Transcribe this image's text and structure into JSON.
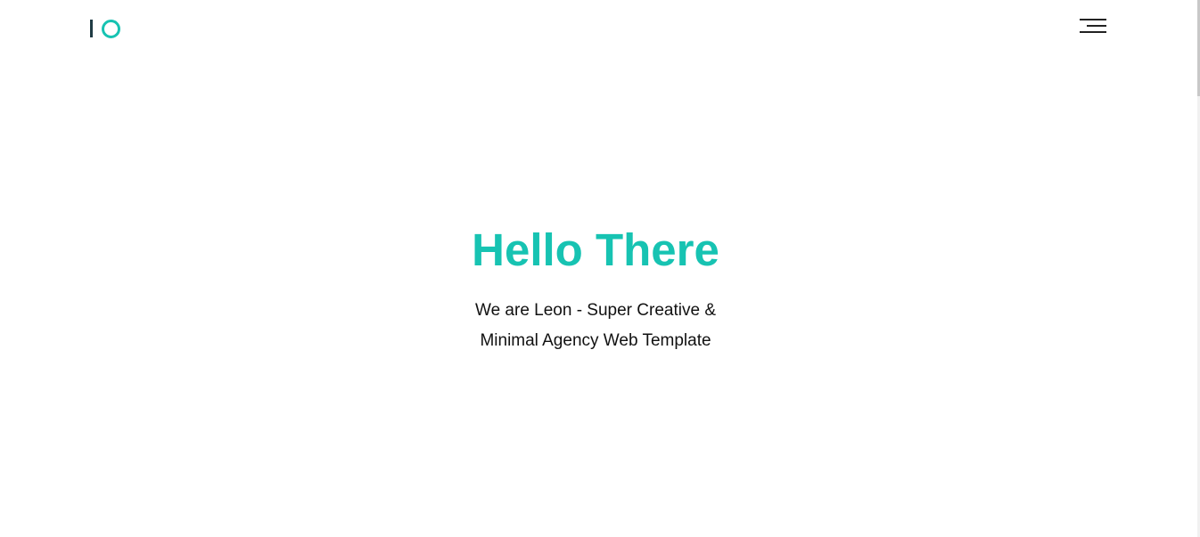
{
  "header": {
    "logo_icon": "io-logo",
    "menu_icon": "hamburger-menu-icon"
  },
  "hero": {
    "title": "Hello There",
    "subtitle_line1": "We are Leon - Super Creative &",
    "subtitle_line2": "Minimal Agency Web Template"
  },
  "colors": {
    "accent": "#17c3b2",
    "logo_dark": "#1f3b44",
    "text": "#111111",
    "background": "#ffffff"
  }
}
